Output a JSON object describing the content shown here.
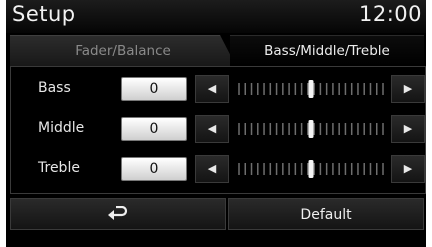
{
  "header": {
    "title": "Setup",
    "clock": "12:00"
  },
  "tabs": [
    {
      "label": "Fader/Balance",
      "active": false
    },
    {
      "label": "Bass/Middle/Treble",
      "active": true
    }
  ],
  "controls": [
    {
      "label": "Bass",
      "value": "0",
      "level": 0.5
    },
    {
      "label": "Middle",
      "value": "0",
      "level": 0.5
    },
    {
      "label": "Treble",
      "value": "0",
      "level": 0.5
    }
  ],
  "buttons": {
    "back_icon": "back-arrow-icon",
    "default_label": "Default"
  },
  "icons": {
    "decrease": "left-arrow-icon",
    "increase": "right-arrow-icon"
  },
  "colors": {
    "background": "#000000",
    "text": "#f2f2f2",
    "value_box": "#ffffff"
  }
}
